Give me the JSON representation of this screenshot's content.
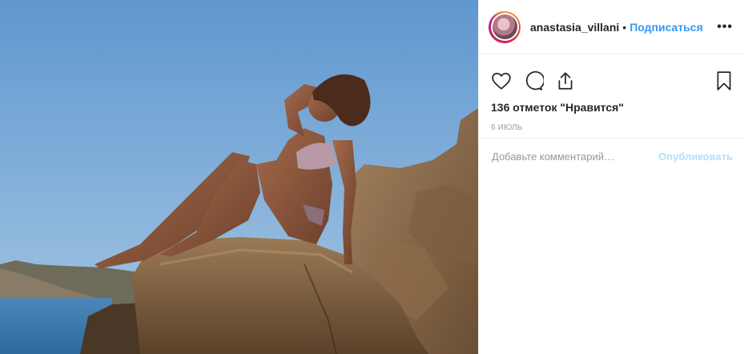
{
  "post": {
    "image_description_icon": "photo"
  },
  "header": {
    "username": "anastasia_villani",
    "separator": "•",
    "follow_label": "Подписаться",
    "more_label": "•••"
  },
  "actions": {
    "like_icon": "heart-icon",
    "comment_icon": "comment-icon",
    "share_icon": "share-icon",
    "save_icon": "bookmark-icon"
  },
  "likes_text": "136 отметок \"Нравится\"",
  "date_text": "6 июль",
  "comment": {
    "placeholder": "Добавьте комментарий…",
    "publish_label": "Опубликовать"
  },
  "colors": {
    "accent": "#3897f0",
    "publish_disabled": "#b2dffc",
    "text": "#262626",
    "muted": "#999999"
  }
}
